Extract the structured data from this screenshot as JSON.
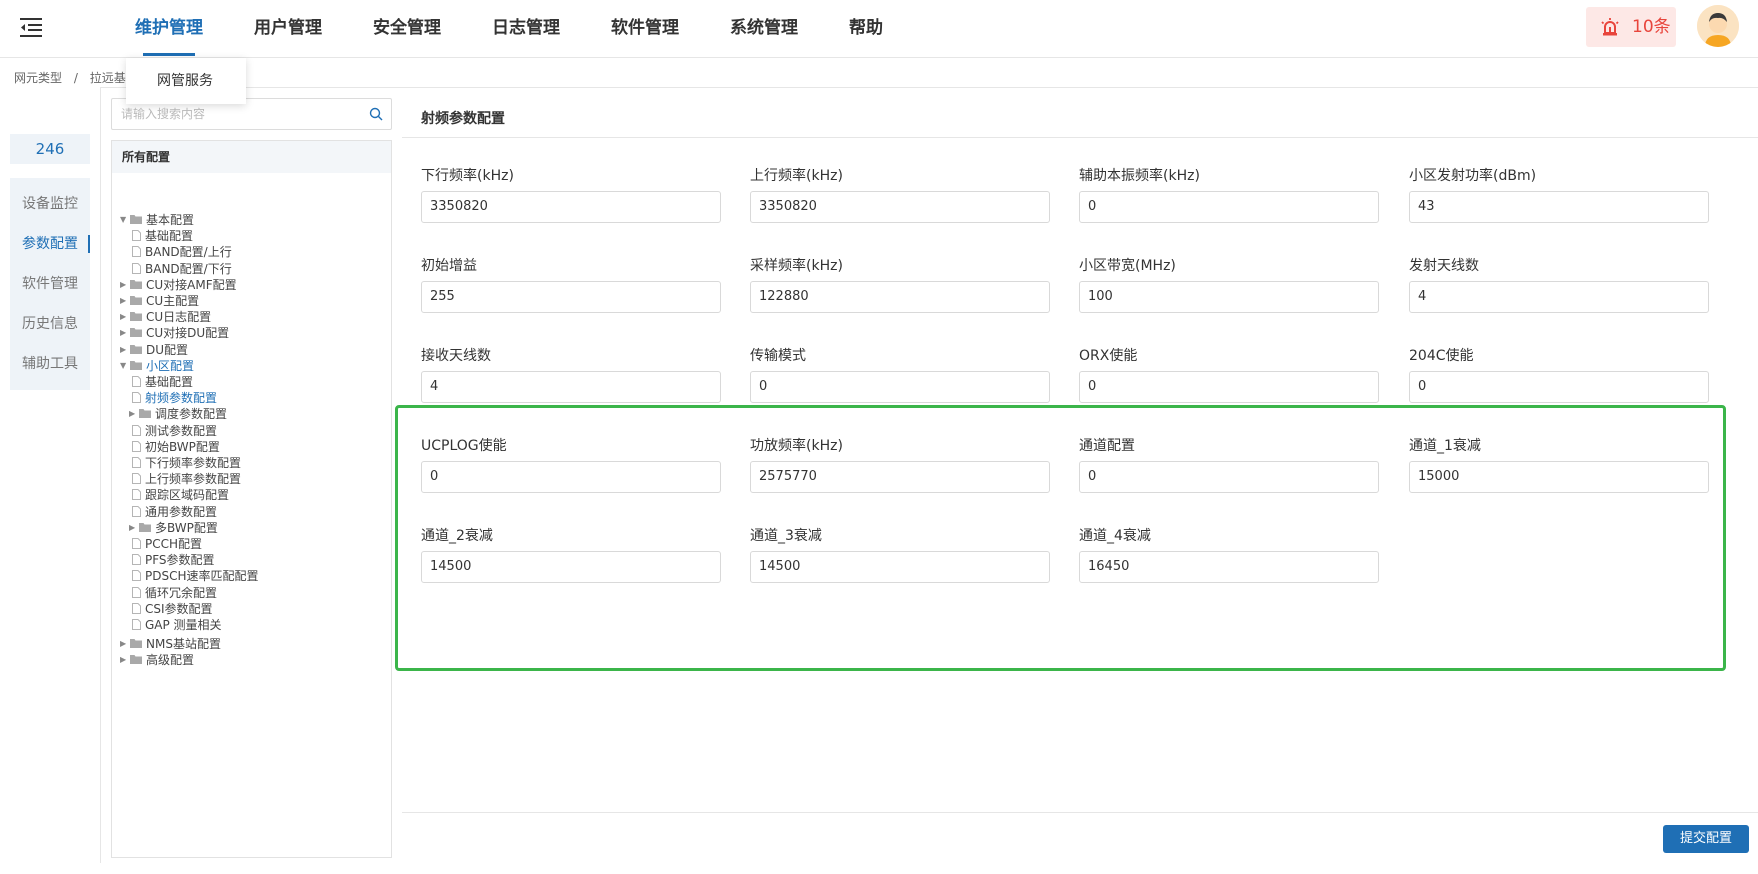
{
  "header": {
    "nav": [
      "维护管理",
      "用户管理",
      "安全管理",
      "日志管理",
      "软件管理",
      "系统管理",
      "帮助"
    ],
    "active_index": 0,
    "alarm_count": "10条"
  },
  "dropdown": {
    "item": "网管服务"
  },
  "breadcrumb": [
    "网元类型",
    "/",
    "拉远基站"
  ],
  "left_nav": {
    "ne_id": "246",
    "items": [
      "设备监控",
      "参数配置",
      "软件管理",
      "历史信息",
      "辅助工具"
    ],
    "active_index": 1
  },
  "search": {
    "placeholder": "请输入搜索内容"
  },
  "tree": {
    "header": "所有配置",
    "nodes": [
      {
        "label": "基本配置",
        "type": "folder",
        "state": "open",
        "level": 0
      },
      {
        "label": "基础配置",
        "type": "file",
        "level": 1
      },
      {
        "label": "BAND配置/上行",
        "type": "file",
        "level": 1
      },
      {
        "label": "BAND配置/下行",
        "type": "file",
        "level": 1
      },
      {
        "label": "CU对接AMF配置",
        "type": "folder",
        "state": "closed",
        "level": 0
      },
      {
        "label": "CU主配置",
        "type": "folder",
        "state": "closed",
        "level": 0
      },
      {
        "label": "CU日志配置",
        "type": "folder",
        "state": "closed",
        "level": 0
      },
      {
        "label": "CU对接DU配置",
        "type": "folder",
        "state": "closed",
        "level": 0
      },
      {
        "label": "DU配置",
        "type": "folder",
        "state": "closed",
        "level": 0
      },
      {
        "label": "小区配置",
        "type": "folder",
        "state": "open",
        "level": 0,
        "highlight": true
      },
      {
        "label": "基础配置",
        "type": "file",
        "level": 1
      },
      {
        "label": "射频参数配置",
        "type": "file",
        "level": 1,
        "selected": true
      },
      {
        "label": "调度参数配置",
        "type": "folder",
        "state": "closed",
        "level": 1
      },
      {
        "label": "测试参数配置",
        "type": "file",
        "level": 1
      },
      {
        "label": "初始BWP配置",
        "type": "file",
        "level": 1
      },
      {
        "label": "下行频率参数配置",
        "type": "file",
        "level": 1
      },
      {
        "label": "上行频率参数配置",
        "type": "file",
        "level": 1
      },
      {
        "label": "跟踪区域码配置",
        "type": "file",
        "level": 1
      },
      {
        "label": "通用参数配置",
        "type": "file",
        "level": 1
      },
      {
        "label": "多BWP配置",
        "type": "folder",
        "state": "closed",
        "level": 1
      },
      {
        "label": "PCCH配置",
        "type": "file",
        "level": 1
      },
      {
        "label": "PFS参数配置",
        "type": "file",
        "level": 1
      },
      {
        "label": "PDSCH速率匹配配置",
        "type": "file",
        "level": 1
      },
      {
        "label": "循环冗余配置",
        "type": "file",
        "level": 1
      },
      {
        "label": "CSI参数配置",
        "type": "file",
        "level": 1
      },
      {
        "label": "GAP 测量相关",
        "type": "file",
        "level": 1
      },
      {
        "label": "NMS基站配置",
        "type": "folder",
        "state": "closed",
        "level": 0
      },
      {
        "label": "高级配置",
        "type": "folder",
        "state": "closed",
        "level": 0
      }
    ]
  },
  "config": {
    "title": "射频参数配置",
    "fields": [
      {
        "label": "下行频率(kHz)",
        "value": "3350820"
      },
      {
        "label": "上行频率(kHz)",
        "value": "3350820"
      },
      {
        "label": "辅助本振频率(kHz)",
        "value": "0"
      },
      {
        "label": "小区发射功率(dBm)",
        "value": "43"
      },
      {
        "label": "初始增益",
        "value": "255"
      },
      {
        "label": "采样频率(kHz)",
        "value": "122880"
      },
      {
        "label": "小区带宽(MHz)",
        "value": "100"
      },
      {
        "label": "发射天线数",
        "value": "4"
      },
      {
        "label": "接收天线数",
        "value": "4"
      },
      {
        "label": "传输模式",
        "value": "0"
      },
      {
        "label": "ORX使能",
        "value": "0"
      },
      {
        "label": "204C使能",
        "value": "0"
      },
      {
        "label": "UCPLOG使能",
        "value": "0"
      },
      {
        "label": "功放频率(kHz)",
        "value": "2575770"
      },
      {
        "label": "通道配置",
        "value": "0"
      },
      {
        "label": "通道_1衰减",
        "value": "15000"
      },
      {
        "label": "通道_2衰减",
        "value": "14500"
      },
      {
        "label": "通道_3衰减",
        "value": "14500"
      },
      {
        "label": "通道_4衰减",
        "value": "16450"
      }
    ]
  },
  "submit_label": "提交配置",
  "colors": {
    "accent": "#1f6fb5",
    "highlight": "#3bb54a",
    "alarm": "#e8453c"
  }
}
